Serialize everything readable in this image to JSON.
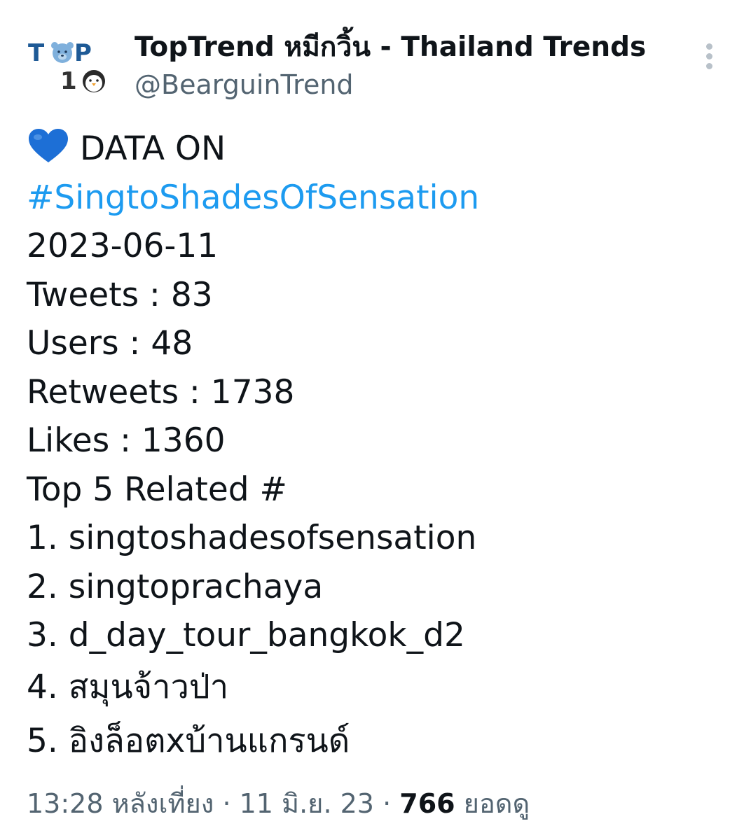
{
  "author": {
    "display_name": "TopTrend หมีกวิ้น - Thailand Trends",
    "handle": "@BearguinTrend",
    "avatar_logo": {
      "top": "TOP",
      "bottom": "10"
    }
  },
  "post": {
    "heart_icon": "blue-heart-icon",
    "heading": "DATA ON",
    "hashtag": "#SingtoShadesOfSensation",
    "date": "2023-06-11",
    "stats": [
      "Tweets : 83",
      "Users : 48",
      "Retweets : 1738",
      "Likes : 1360"
    ],
    "related_heading": "Top 5 Related #",
    "related": [
      "1. singtoshadesofsensation",
      "2. singtoprachaya",
      "3. d_day_tour_bangkok_d2",
      "4. สมุนจ้าวป่า",
      "5. อิงล็อตxบ้านแกรนด์"
    ]
  },
  "meta": {
    "time": "13:28 หลังเที่ยง",
    "separator": "·",
    "date": "11 มิ.ย. 23",
    "views_count": "766",
    "views_label": "ยอดดู"
  },
  "colors": {
    "link": "#1d9bf0",
    "text": "#0f1419",
    "secondary": "#536471",
    "logo_blue": "#1e5a96",
    "heart": "#1d6fd6"
  },
  "icons": {
    "more": "more-vertical-icon",
    "heart": "blue-heart-icon"
  }
}
